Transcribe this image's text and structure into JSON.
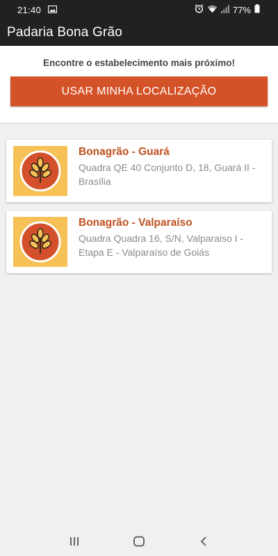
{
  "status_bar": {
    "time": "21:40",
    "battery": "77%",
    "icons": [
      "image-icon",
      "alarm-icon",
      "wifi-icon",
      "signal-icon",
      "battery-icon"
    ]
  },
  "app_bar": {
    "title": "Padaria Bona Grão"
  },
  "locator": {
    "text": "Encontre o estabelecimento mais próximo!",
    "button_label": "USAR MINHA LOCALIZAÇÃO"
  },
  "stores": [
    {
      "name": "Bonagrão - Guará",
      "address": "Quadra QE 40 Conjunto D, 18, Guará II - Brasília"
    },
    {
      "name": "Bonagrão - Valparaíso",
      "address": "Quadra Quadra 16, S/N, Valparaiso I - Etapa E - Valparaíso de Goiás"
    }
  ],
  "nav_bar": {
    "buttons": [
      "recent-apps-icon",
      "home-icon",
      "back-icon"
    ]
  },
  "colors": {
    "accent": "#d45227",
    "store_name": "#c0511f",
    "logo_bg": "#f6c156",
    "logo_circle": "#d4502a",
    "bar_bg": "#212121",
    "page_bg": "#eff0f2"
  }
}
